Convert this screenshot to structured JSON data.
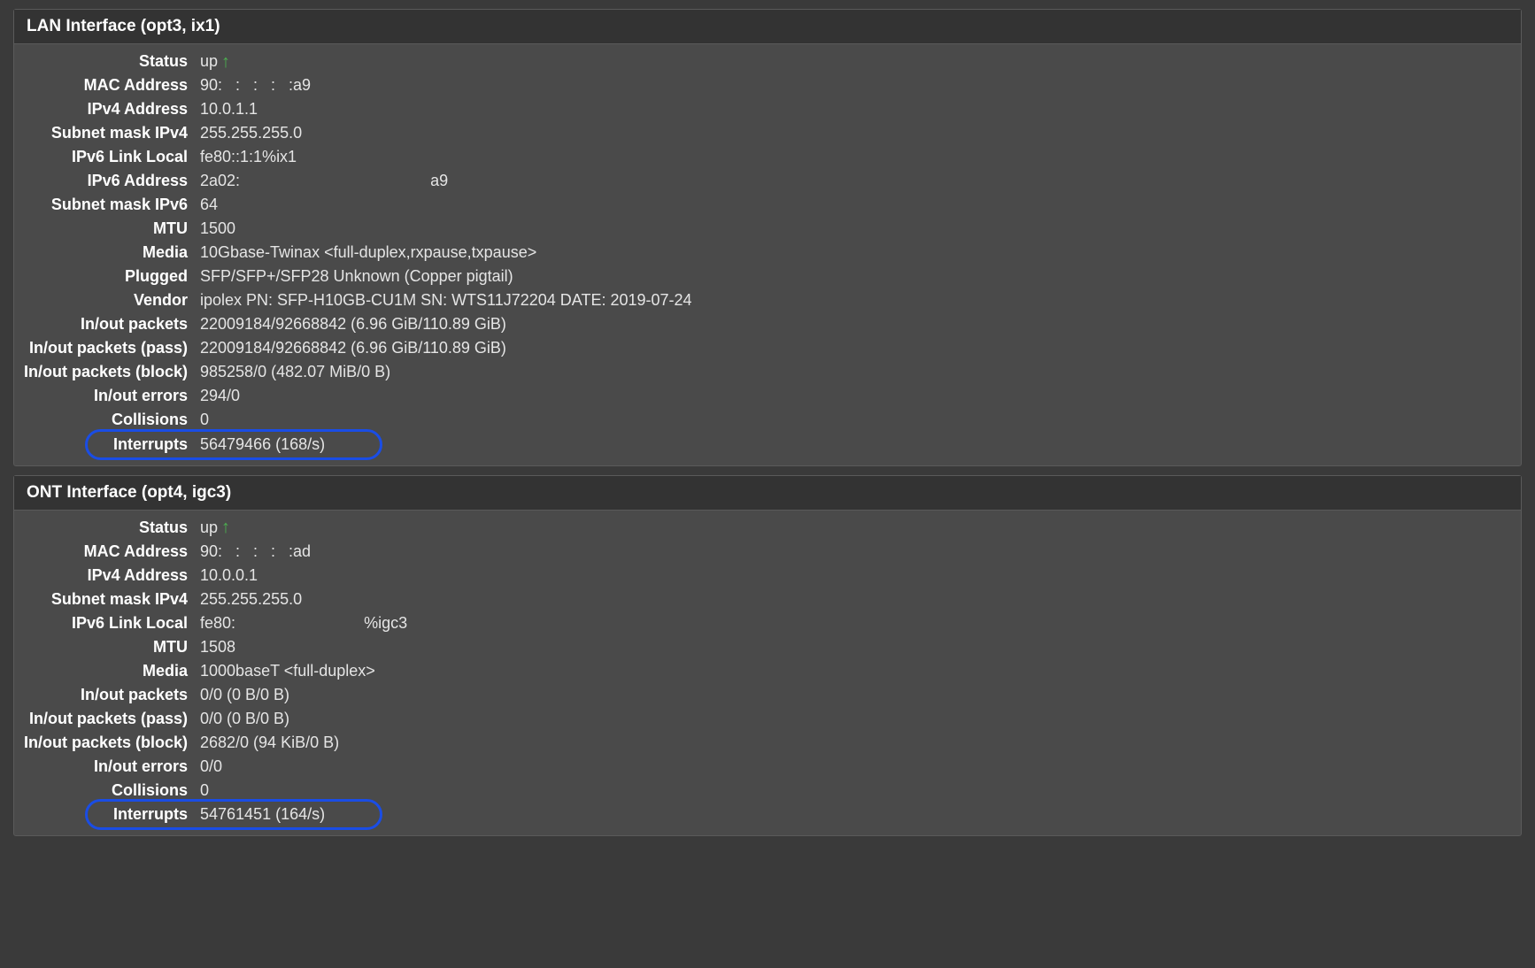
{
  "panels": [
    {
      "title": "LAN Interface (opt3, ix1)",
      "rows": [
        {
          "label": "Status",
          "value": "up",
          "status": true
        },
        {
          "label": "MAC Address",
          "value": "90:   :   :   :   :a9"
        },
        {
          "label": "IPv4 Address",
          "value": "10.0.1.1"
        },
        {
          "label": "Subnet mask IPv4",
          "value": "255.255.255.0"
        },
        {
          "label": "IPv6 Link Local",
          "value": "fe80::1:1%ix1"
        },
        {
          "label": "IPv6 Address",
          "value": "2a02:                                           a9"
        },
        {
          "label": "Subnet mask IPv6",
          "value": "64"
        },
        {
          "label": "MTU",
          "value": "1500"
        },
        {
          "label": "Media",
          "value": "10Gbase-Twinax <full-duplex,rxpause,txpause>"
        },
        {
          "label": "Plugged",
          "value": "SFP/SFP+/SFP28 Unknown (Copper pigtail)"
        },
        {
          "label": "Vendor",
          "value": "ipolex PN: SFP-H10GB-CU1M SN: WTS11J72204 DATE: 2019-07-24"
        },
        {
          "label": "In/out packets",
          "value": "22009184/92668842 (6.96 GiB/110.89 GiB)"
        },
        {
          "label": "In/out packets (pass)",
          "value": "22009184/92668842 (6.96 GiB/110.89 GiB)"
        },
        {
          "label": "In/out packets (block)",
          "value": "985258/0 (482.07 MiB/0 B)"
        },
        {
          "label": "In/out errors",
          "value": "294/0"
        },
        {
          "label": "Collisions",
          "value": "0"
        },
        {
          "label": "Interrupts",
          "value": "56479466 (168/s)",
          "highlight": true
        }
      ]
    },
    {
      "title": "ONT Interface (opt4, igc3)",
      "rows": [
        {
          "label": "Status",
          "value": "up",
          "status": true
        },
        {
          "label": "MAC Address",
          "value": "90:   :   :   :   :ad"
        },
        {
          "label": "IPv4 Address",
          "value": "10.0.0.1"
        },
        {
          "label": "Subnet mask IPv4",
          "value": "255.255.255.0"
        },
        {
          "label": "IPv6 Link Local",
          "value": "fe80:                             %igc3"
        },
        {
          "label": "MTU",
          "value": "1508"
        },
        {
          "label": "Media",
          "value": "1000baseT <full-duplex>"
        },
        {
          "label": "In/out packets",
          "value": "0/0 (0 B/0 B)"
        },
        {
          "label": "In/out packets (pass)",
          "value": "0/0 (0 B/0 B)"
        },
        {
          "label": "In/out packets (block)",
          "value": "2682/0 (94 KiB/0 B)"
        },
        {
          "label": "In/out errors",
          "value": "0/0"
        },
        {
          "label": "Collisions",
          "value": "0"
        },
        {
          "label": "Interrupts",
          "value": "54761451 (164/s)",
          "highlight": true
        }
      ]
    }
  ]
}
